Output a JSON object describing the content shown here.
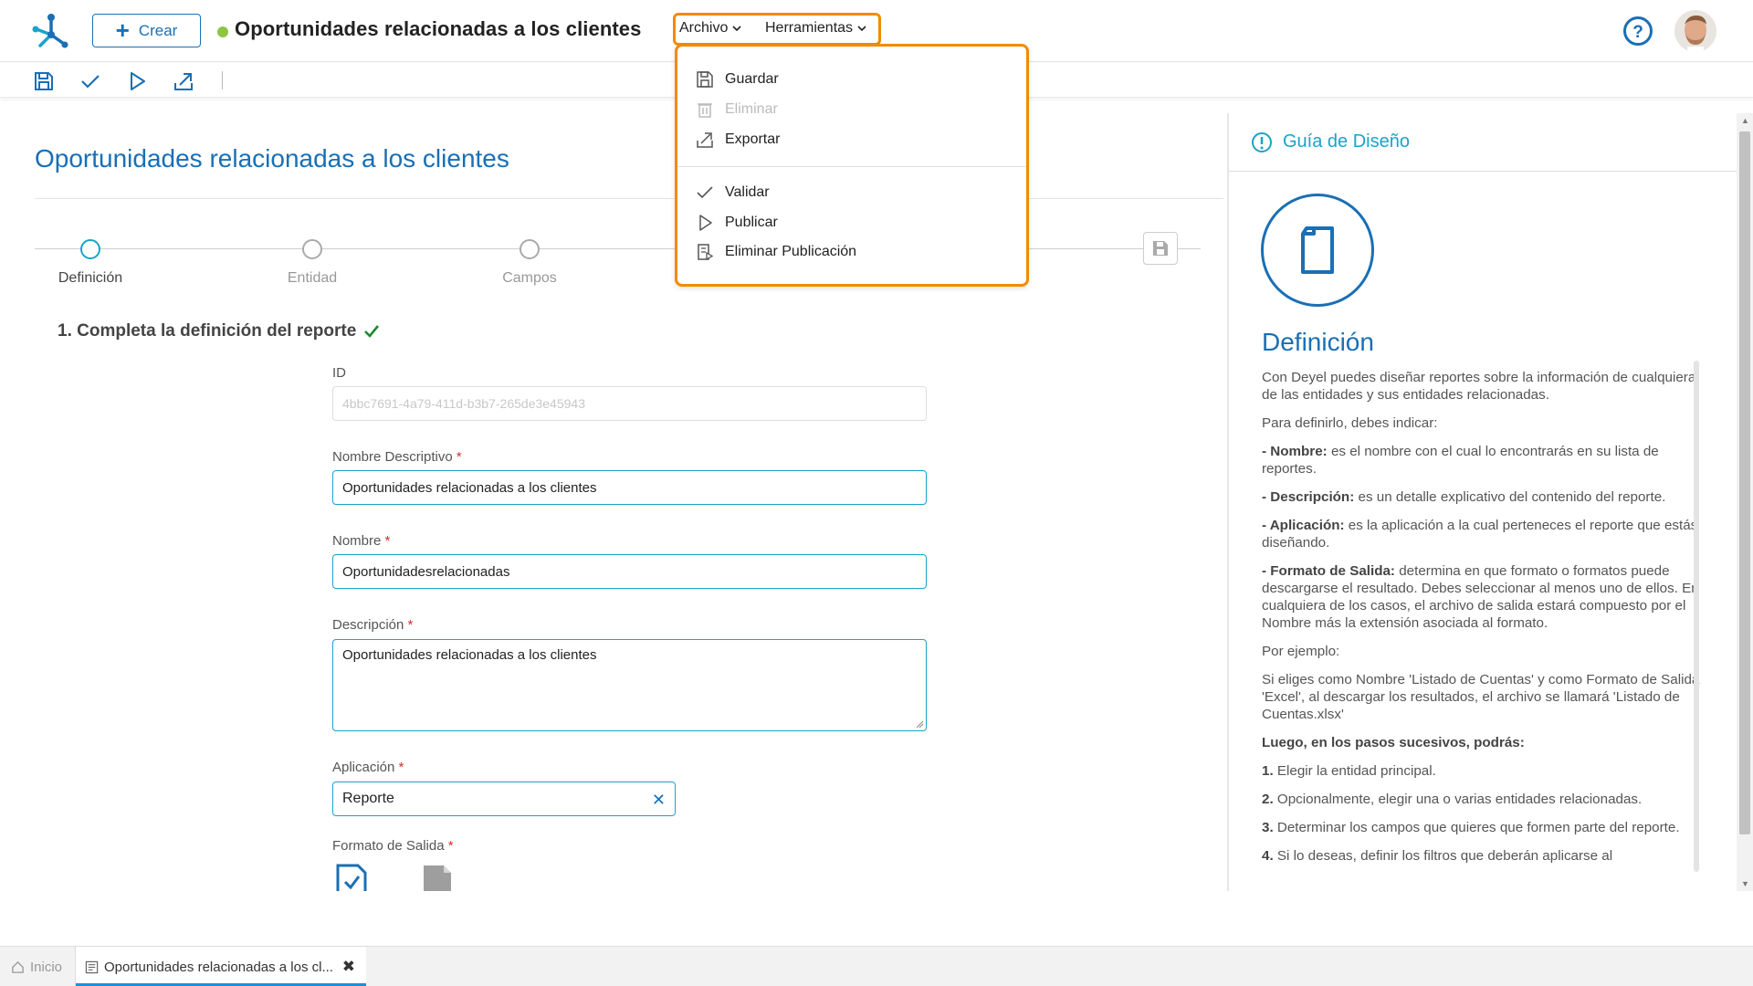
{
  "header": {
    "create_label": "Crear",
    "doc_title": "Oportunidades relacionadas a los clientes",
    "menus": [
      "Archivo",
      "Herramientas"
    ]
  },
  "toolbar": {
    "icons": [
      "save-icon",
      "check-icon",
      "play-icon",
      "export-icon"
    ]
  },
  "archivo_menu": {
    "items": [
      {
        "label": "Guardar",
        "icon": "save-icon",
        "enabled": true
      },
      {
        "label": "Eliminar",
        "icon": "trash-icon",
        "enabled": false
      },
      {
        "label": "Exportar",
        "icon": "export-icon",
        "enabled": true
      },
      {
        "label": "Validar",
        "icon": "check-icon",
        "enabled": true
      },
      {
        "label": "Publicar",
        "icon": "play-icon",
        "enabled": true
      },
      {
        "label": "Eliminar Publicación",
        "icon": "unpublish-icon",
        "enabled": true
      }
    ]
  },
  "main": {
    "heading": "Oportunidades relacionadas a los clientes",
    "steps": [
      {
        "label": "Definición",
        "active": true
      },
      {
        "label": "Entidad",
        "active": false
      },
      {
        "label": "Campos",
        "active": false
      }
    ],
    "section_title": "1. Completa la definición del reporte",
    "form": {
      "id_label": "ID",
      "id_value": "4bbc7691-4a79-411d-b3b7-265de3e45943",
      "nombre_desc_label": "Nombre Descriptivo",
      "nombre_desc_value": "Oportunidades relacionadas a los clientes",
      "nombre_label": "Nombre",
      "nombre_value": "Oportunidadesrelacionadas",
      "descripcion_label": "Descripción",
      "descripcion_value": "Oportunidades relacionadas a los clientes",
      "aplicacion_label": "Aplicación",
      "aplicacion_value": "Reporte",
      "formato_label": "Formato de Salida",
      "required_mark": "*"
    }
  },
  "guide": {
    "title": "Guía de Diseño",
    "def_title": "Definición",
    "p1": "Con Deyel puedes diseñar reportes sobre la información de cualquiera de las entidades y sus entidades relacionadas.",
    "p2": "Para definirlo, debes indicar:",
    "nombre_b": "- Nombre:",
    "nombre_t": " es el nombre con el cual lo encontrarás en su lista de reportes.",
    "desc_b": "- Descripción:",
    "desc_t": " es un detalle explicativo del contenido del reporte.",
    "apl_b": "- Aplicación:",
    "apl_t": " es la aplicación a la cual perteneces el reporte que estás diseñando.",
    "fmt_b": "- Formato de Salida:",
    "fmt_t": " determina en que formato o formatos puede descargarse el resultado. Debes seleccionar al menos uno de ellos. En cualquiera de los casos, el archivo de salida estará compuesto por el Nombre más la extensión asociada al formato.",
    "p_ej": "Por ejemplo:",
    "p_ej2": "Si eliges como Nombre 'Listado de Cuentas' y como Formato de Salida 'Excel', al descargar los resultados, el archivo se llamará 'Listado de Cuentas.xlsx'",
    "luego": "Luego, en los pasos sucesivos, podrás:",
    "s1_n": "1.",
    "s1_t": " Elegir la entidad principal.",
    "s2_n": "2.",
    "s2_t": " Opcionalmente, elegir una o varias entidades relacionadas.",
    "s3_n": "3.",
    "s3_t": " Determinar los campos que quieres que formen parte del reporte.",
    "s4_n": "4.",
    "s4_t": " Si lo deseas, definir los filtros que deberán aplicarse al"
  },
  "bottom_tabs": {
    "home": "Inicio",
    "active": "Oportunidades relacionadas a los cl..."
  },
  "colors": {
    "brand_blue": "#1a6fb5",
    "accent_cyan": "#1aa3c9",
    "highlight_orange": "#f08c00",
    "status_green": "#8cc63f"
  }
}
